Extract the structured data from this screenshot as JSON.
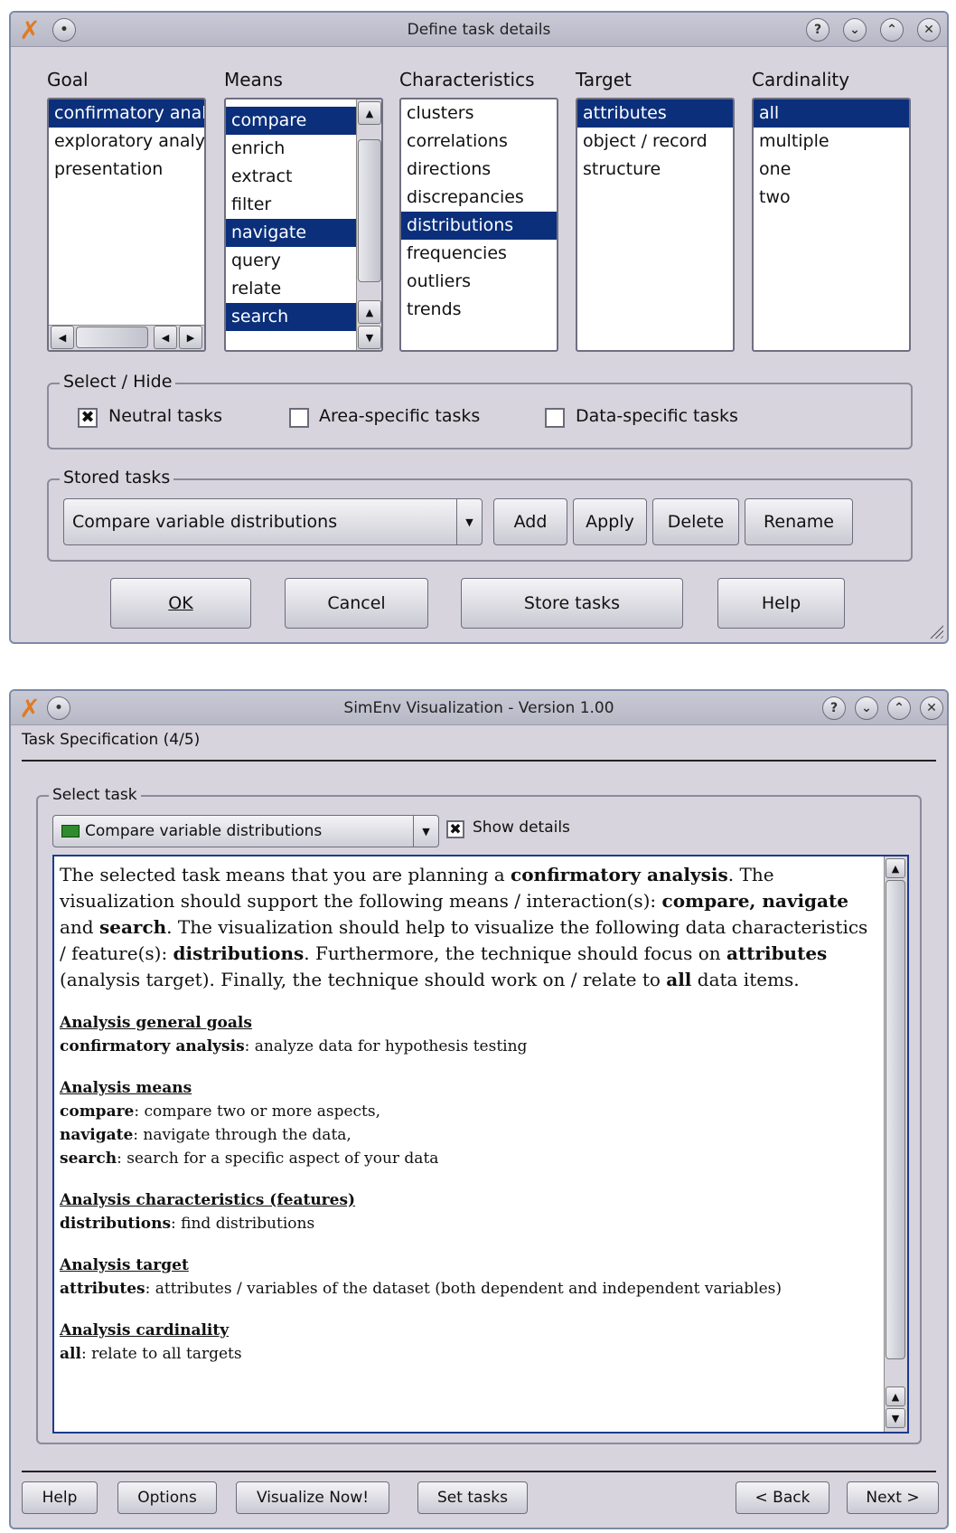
{
  "dialog": {
    "title": "Define task details",
    "columns": {
      "goal": {
        "label": "Goal",
        "items": [
          "confirmatory anal",
          "exploratory analy",
          "presentation"
        ]
      },
      "means": {
        "label": "Means",
        "items": [
          "compare",
          "enrich",
          "extract",
          "filter",
          "navigate",
          "query",
          "relate",
          "search"
        ]
      },
      "characteristics": {
        "label": "Characteristics",
        "items": [
          "clusters",
          "correlations",
          "directions",
          "discrepancies",
          "distributions",
          "frequencies",
          "outliers",
          "trends"
        ]
      },
      "target": {
        "label": "Target",
        "items": [
          "attributes",
          "object / record",
          "structure"
        ]
      },
      "cardinality": {
        "label": "Cardinality",
        "items": [
          "all",
          "multiple",
          "one",
          "two"
        ]
      }
    },
    "select_hide": {
      "title": "Select / Hide",
      "neutral": "Neutral tasks",
      "neutral_checked": "✖",
      "area": "Area-specific tasks",
      "data": "Data-specific tasks"
    },
    "stored": {
      "title": "Stored tasks",
      "value": "Compare variable distributions",
      "add": "Add",
      "apply": "Apply",
      "delete": "Delete",
      "rename": "Rename"
    },
    "buttons": {
      "ok": "OK",
      "cancel": "Cancel",
      "store": "Store tasks",
      "help": "Help"
    }
  },
  "wizard": {
    "title": "SimEnv Visualization - Version 1.00",
    "step": "Task Specification (4/5)",
    "select_title": "Select task",
    "task_value": "Compare variable distributions",
    "show_details": "Show details",
    "show_details_checked": "✖",
    "desc": {
      "p1": "The selected task means that you are planning a ",
      "b1": "confirmatory analysis",
      "p2": ". The visualization should support the following means / interaction(s): ",
      "b2": "compare, navigate",
      "p3": " and ",
      "b3": "search",
      "p4": ". The visualization should help to visualize the following data characteristics / feature(s): ",
      "b4": "distributions",
      "p5": ". Furthermore, the technique should focus on ",
      "b5": "attributes",
      "p6": " (analysis target). Finally, the technique should work on / relate to ",
      "b6": "all",
      "p7": " data items."
    },
    "sections": {
      "goals_h": "Analysis general goals",
      "goals_term": "confirmatory analysis",
      "goals_desc": ": analyze data for hypothesis testing",
      "means_h": "Analysis means",
      "m1_term": "compare",
      "m1_desc": ": compare two or more aspects,",
      "m2_term": "navigate",
      "m2_desc": ": navigate through the data,",
      "m3_term": "search",
      "m3_desc": ": search for a specific aspect of your data",
      "char_h": "Analysis characteristics (features)",
      "char_term": "distributions",
      "char_desc": ": find distributions",
      "target_h": "Analysis target",
      "target_term": "attributes",
      "target_desc": ": attributes / variables of the dataset (both dependent and independent variables)",
      "card_h": "Analysis cardinality",
      "card_term": "all",
      "card_desc": ": relate to all targets"
    },
    "buttons": {
      "help": "Help",
      "options": "Options",
      "visualize": "Visualize Now!",
      "set_tasks": "Set tasks",
      "back": "< Back",
      "next": "Next >"
    }
  }
}
